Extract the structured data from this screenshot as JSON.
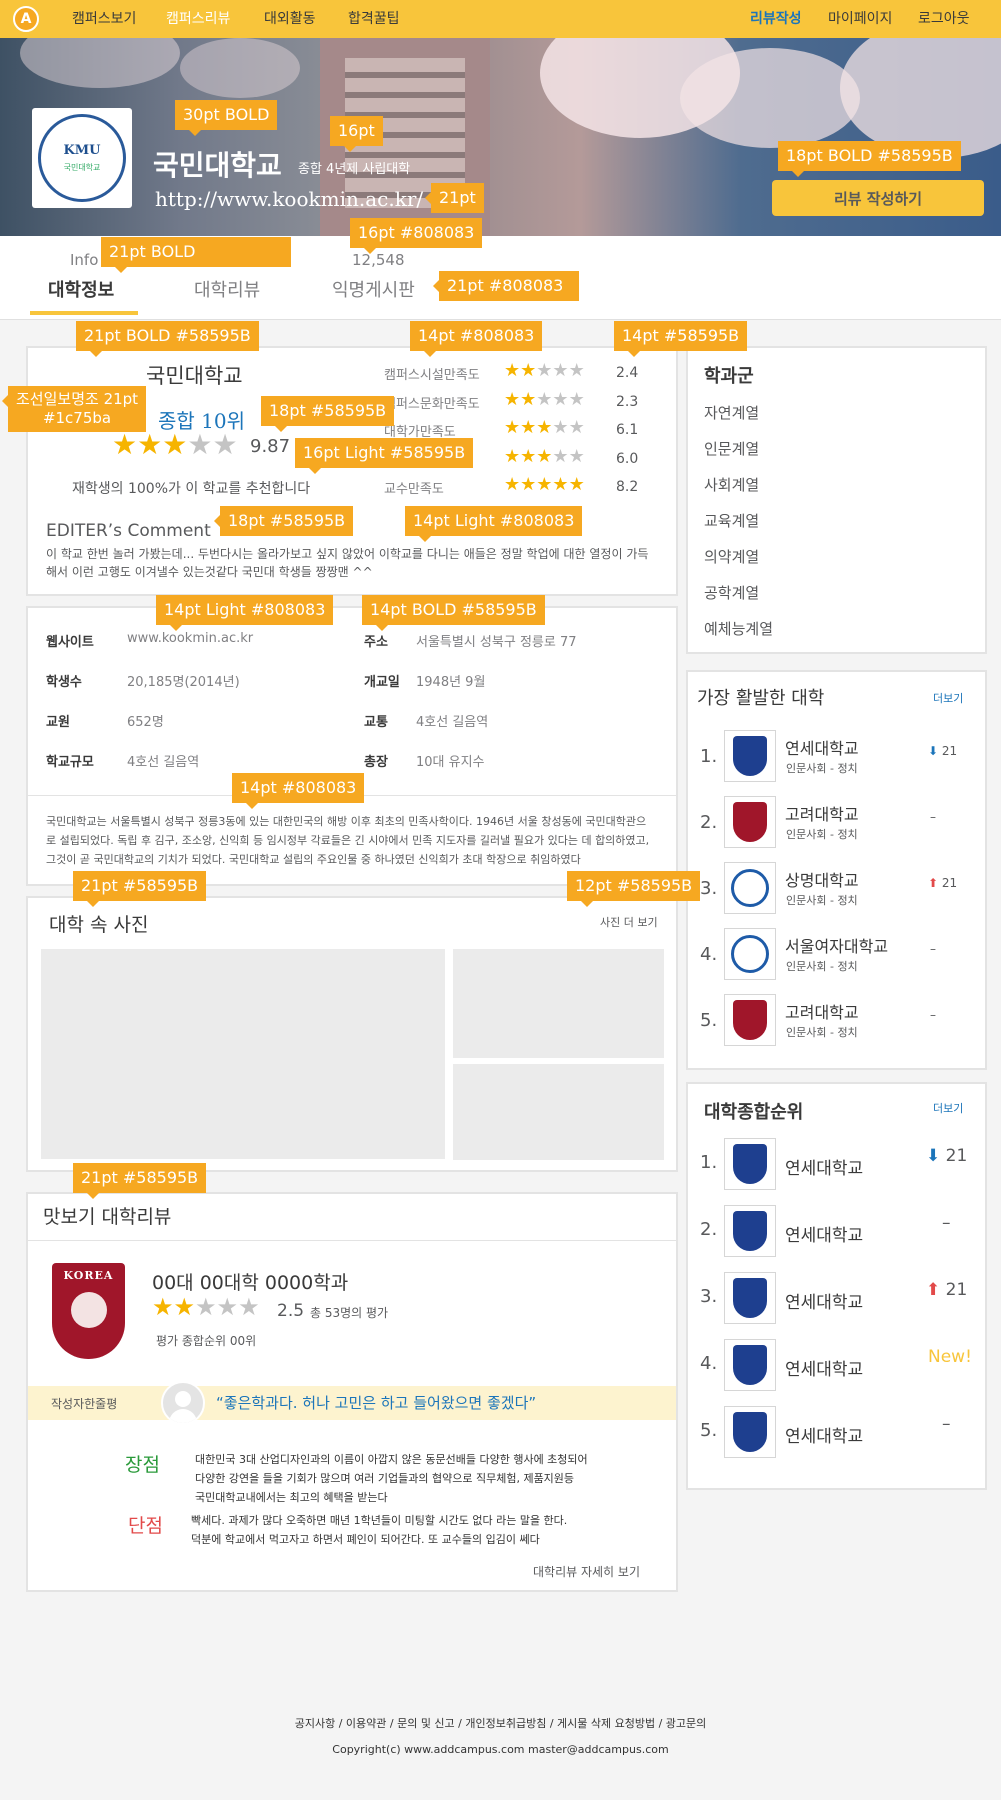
{
  "nav": {
    "logo": "A",
    "items": [
      "캠퍼스보기",
      "캠퍼스리뷰",
      "대외활동",
      "합격꿀팁"
    ],
    "right": [
      "리뷰작성",
      "마이페이지",
      "로그아웃"
    ]
  },
  "hero": {
    "logo_text": "KMU",
    "logo_sub": "국민대학교",
    "title": "국민대학교",
    "subtitle": "종합 4년제 사립대학",
    "url": "http://www.kookmin.ac.kr/",
    "review_button": "리뷰 작성하기"
  },
  "annotations": {
    "a1": "30pt BOLD",
    "a2": "16pt",
    "a3": "21pt",
    "a4": "18pt  BOLD   #58595B",
    "a5": "21pt  BOLD",
    "a6": "16pt  #808083",
    "a7": "21pt  #808083",
    "a8": "21pt  BOLD   #58595B",
    "a9": "14pt   #808083",
    "a10": "14pt   #58595B",
    "a11": "조선일보명조 21pt\n#1c75ba",
    "a12": "18pt   #58595B",
    "a13": "16pt   Light   #58595B",
    "a14": "18pt   #58595B",
    "a15": "14pt  Light  #808083",
    "a16": "14pt  Light  #808083",
    "a17": "14pt  BOLD  #58595B",
    "a18": "14pt    #808083",
    "a19": "21pt  #58595B",
    "a20": "12pt   #58595B",
    "a21": "21pt  #58595B"
  },
  "tabs": {
    "info_label": "Info",
    "count": "12,548",
    "items": [
      "대학정보",
      "대학리뷰",
      "익명게시판"
    ]
  },
  "summary": {
    "name": "국민대학교",
    "rank": "종합 10위",
    "score": "9.87",
    "rating": 3,
    "recommend": "재학생의 100%가 이 학교를 추천합니다",
    "metrics": [
      {
        "label": "캠퍼스시설만족도",
        "rating": 2,
        "value": "2.4"
      },
      {
        "label": "캠퍼스문화만족도",
        "rating": 2,
        "value": "2.3"
      },
      {
        "label": "대학가만족도",
        "rating": 3,
        "value": "6.1"
      },
      {
        "label": "",
        "rating": 3,
        "value": "6.0"
      },
      {
        "label": "교수만족도",
        "rating": 5,
        "value": "8.2"
      }
    ],
    "comment_title": "EDITER’s Comment",
    "comment": " 이 학교 한번 놀러 가봤는데... 두번다시는 올라가보고 싶지 않았어 이학교를 다니는 애들은 정말 학업에 대한 열정이 가득해서 이런 고행도 이겨낼수 있는것같다 국민대 학생들 짱짱맨 ^^"
  },
  "details": {
    "rows": [
      {
        "l1": "웹사이트",
        "v1": "www.kookmin.ac.kr",
        "l2": "주소",
        "v2": "서울특별시 성북구 정릉로 77"
      },
      {
        "l1": "학생수",
        "v1": "20,185명(2014년)",
        "l2": "개교일",
        "v2": "1948년 9월"
      },
      {
        "l1": "교원",
        "v1": "652명",
        "l2": "교통",
        "v2": "4호선 길음역"
      },
      {
        "l1": "학교규모",
        "v1": "4호선 길음역",
        "l2": "총장",
        "v2": "10대 유지수"
      }
    ],
    "description": "국민대학교는 서울특별시 성북구 정릉3동에 있는 대한민국의 해방 이후 최초의 민족사학이다. 1946년 서울 창성동에 국민대학관으로 설립되었다. 독립 후 김구, 조소앙, 신익희 등 임시정부 각료들은 긴 시야에서 민족 지도자를 길러낼 필요가 있다는 데 합의하였고, 그것이 곧 국민대학교의 기치가 되었다. 국민대학교 설립의 주요인물 중 하나였던 신익희가 초대 학장으로 취임하였다"
  },
  "photos": {
    "title": "대학 속 사진",
    "more": "사진 더 보기"
  },
  "review": {
    "section_title": "맛보기 대학리뷰",
    "logo_text": "KOREA",
    "dept": "00대 00대학 0000학과",
    "rating": 2.5,
    "score": "2.5",
    "count": "총 53명의 평가",
    "rank": "평가 종합순위 00위",
    "author_label": "작성자한줄평",
    "quote": "“좋은학과다. 허나 고민은 하고 들어왔으면 좋겠다”",
    "pros_label": "장점",
    "pros": "대한민국 3대 산업디자인과의 이름이 아깝지 않은 동문선배들 다양한 행사에 초청되어\n다양한 강연을 들을 기회가 많으며 여러 기업들과의 협약으로 직무체험, 제품지원등\n국민대학교내에서는 최고의 혜택을 받는다",
    "cons_label": "단점",
    "cons": "빡세다. 과제가 많다 오죽하면 매년 1학년들이 미팅할 시간도 없다 라는 말을 한다.\n덕분에 학교에서 먹고자고 하면서 폐인이 되어간다. 또 교수들의 입김이 쎄다",
    "more": "대학리뷰 자세히 보기"
  },
  "categories": {
    "title": "학과군",
    "items": [
      "자연계열",
      "인문계열",
      "사회계열",
      "교육계열",
      "의약계열",
      "공학계열",
      "예체능계열"
    ]
  },
  "active": {
    "title": "가장 활발한 대학",
    "more": "더보기",
    "items": [
      {
        "num": "1.",
        "name": "연세대학교",
        "sub": "인문사회 - 정치",
        "trend": "down",
        "change": "21",
        "logo": "yonsei"
      },
      {
        "num": "2.",
        "name": "고려대학교",
        "sub": "인문사회 - 정치",
        "trend": "none",
        "change": "–",
        "logo": "korea"
      },
      {
        "num": "3.",
        "name": "상명대학교",
        "sub": "인문사회 - 정치",
        "trend": "up",
        "change": "21",
        "logo": "sangmyung"
      },
      {
        "num": "4.",
        "name": "서울여자대학교",
        "sub": "인문사회 - 정치",
        "trend": "none",
        "change": "–",
        "logo": "swu"
      },
      {
        "num": "5.",
        "name": "고려대학교",
        "sub": "인문사회 - 정치",
        "trend": "none",
        "change": "–",
        "logo": "korea"
      }
    ]
  },
  "overall": {
    "title": "대학종합순위",
    "more": "더보기",
    "items": [
      {
        "num": "1.",
        "name": "연세대학교",
        "trend": "down",
        "change": "21"
      },
      {
        "num": "2.",
        "name": "연세대학교",
        "trend": "none",
        "change": "–"
      },
      {
        "num": "3.",
        "name": "연세대학교",
        "trend": "up",
        "change": "21"
      },
      {
        "num": "4.",
        "name": "연세대학교",
        "trend": "new",
        "change": "New!"
      },
      {
        "num": "5.",
        "name": "연세대학교",
        "trend": "none",
        "change": "–"
      }
    ]
  },
  "footer": {
    "links": "공지사항   /  이용약관   /  문의 및 신고  /  개인정보취급방침  /  게시물 삭제 요청방법  /  광고문의",
    "copyright": "Copyright(c) www.addcampus.com    master@addcampus.com"
  },
  "colors": {
    "accent": "#f8c53b",
    "tag": "#f6a821",
    "text": "#58595b",
    "muted": "#808083",
    "blue": "#1c75ba",
    "pros": "#2a9a3a",
    "cons": "#e24a4a"
  }
}
